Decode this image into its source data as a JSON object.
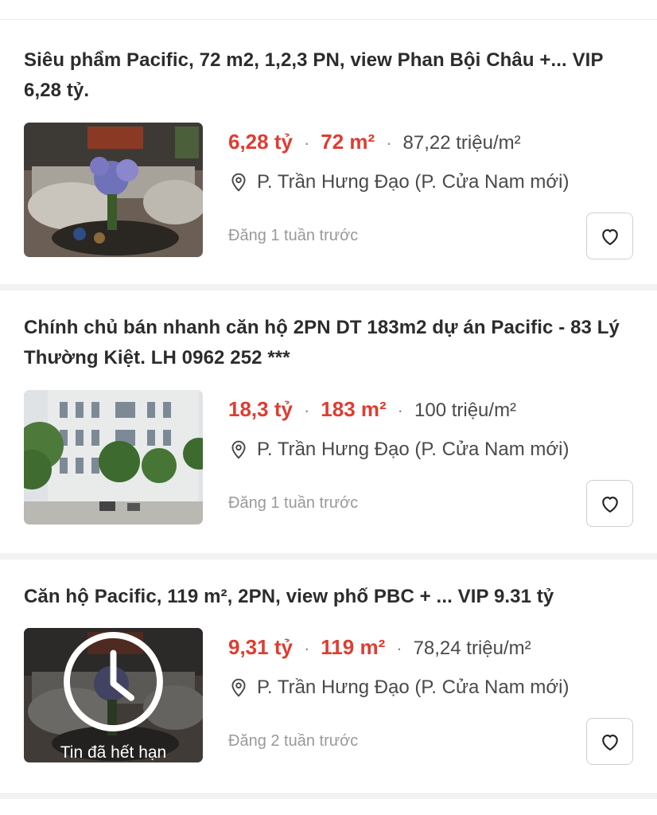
{
  "listings": [
    {
      "title": "Siêu phẩm Pacific, 72 m2, 1,2,3 PN, view Phan Bội Châu +... VIP 6,28 tỷ.",
      "price": "6,28 tỷ",
      "area": "72 m²",
      "price_per_m2": "87,22 triệu/m²",
      "address": "P. Trần Hưng Đạo (P. Cửa Nam mới)",
      "posted": "Đăng 1 tuần trước",
      "separator": "·",
      "expired": false
    },
    {
      "title": "Chính chủ bán nhanh căn hộ 2PN DT 183m2 dự án Pacific - 83 Lý Thường Kiệt. LH 0962 252 ***",
      "price": "18,3 tỷ",
      "area": "183 m²",
      "price_per_m2": "100 triệu/m²",
      "address": "P. Trần Hưng Đạo (P. Cửa Nam mới)",
      "posted": "Đăng 1 tuần trước",
      "separator": "·",
      "expired": false
    },
    {
      "title": "Căn hộ Pacific, 119 m², 2PN, view phố PBC + ... VIP 9.31 tỷ",
      "price": "9,31 tỷ",
      "area": "119 m²",
      "price_per_m2": "78,24 triệu/m²",
      "address": "P. Trần Hưng Đạo (P. Cửa Nam mới)",
      "posted": "Đăng 2 tuần trước",
      "separator": "·",
      "expired": true,
      "expired_label": "Tin đã hết hạn"
    }
  ],
  "icons": {
    "location": "location-pin-icon",
    "favorite": "heart-outline-icon",
    "expired": "clock-icon"
  },
  "colors": {
    "price": "#e03c31",
    "muted": "#999999",
    "divider": "#f2f2f2"
  }
}
